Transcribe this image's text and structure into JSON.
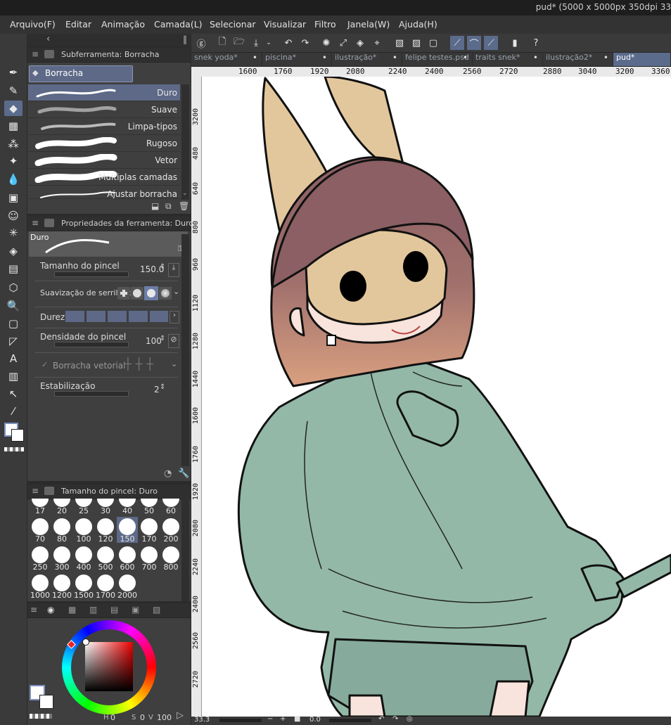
{
  "window": {
    "title": "pud* (5000 x 5000px 350dpi 33"
  },
  "menu": [
    "Arquivo(F)",
    "Editar",
    "Animação",
    "Camada(L)",
    "Selecionar",
    "Visualizar",
    "Filtro",
    "Janela(W)",
    "Ajuda(H)"
  ],
  "subtool_panel": {
    "title": "Subferramenta: Borracha",
    "group_tab": "Borracha",
    "items": [
      "Duro",
      "Suave",
      "Limpa-tipos",
      "Rugoso",
      "Vetor",
      "Múltiplas camadas",
      "Ajustar borracha"
    ],
    "selected": "Duro"
  },
  "tool_property": {
    "title": "Propriedades da ferramenta: Duro",
    "preview_label": "Duro",
    "brush_size_label": "Tamanho do pincel",
    "brush_size_value": "150.0",
    "antialias_label": "Suavização de serrilhado",
    "hardness_label": "Dureza",
    "density_label": "Densidade do pincel",
    "density_value": "100",
    "vector_eraser_label": "Borracha vetorial",
    "stabilization_label": "Estabilização",
    "stabilization_value": "2"
  },
  "brush_size_panel": {
    "title": "Tamanho do pincel: Duro",
    "sizes": [
      "17",
      "20",
      "25",
      "30",
      "40",
      "50",
      "60",
      "70",
      "80",
      "100",
      "120",
      "150",
      "170",
      "200",
      "250",
      "300",
      "400",
      "500",
      "600",
      "700",
      "800",
      "1000",
      "1200",
      "1500",
      "1700",
      "2000"
    ],
    "selected": "150"
  },
  "color_panel": {
    "bottom_values": [
      "0",
      "0",
      "100"
    ],
    "bottom_labels": [
      "H",
      "S",
      "V"
    ]
  },
  "canvas_tabs": [
    "snek yoda*",
    "piscina*",
    "ilustração*",
    "felipe testes.psd",
    "traits snek*",
    "ilustração2*",
    "pud*"
  ],
  "active_tab": "pud*",
  "ruler_top": [
    "1600",
    "1760",
    "1920",
    "2080",
    "2240",
    "2400",
    "2560",
    "2720",
    "2880",
    "3040",
    "3200",
    "3360"
  ],
  "ruler_left": [
    "3200",
    "480",
    "640",
    "800",
    "960",
    "1120",
    "1280",
    "1440",
    "1600",
    "1760",
    "1920",
    "2080",
    "2240",
    "2400",
    "2560",
    "2720"
  ],
  "status": {
    "zoom": "33.3",
    "angle": "0.0"
  },
  "colors": {
    "accent": "#5d6987",
    "hair_top": "#8b5f63",
    "hair_bottom": "#d9a080",
    "hoodie": "#93b8a8",
    "ears": "#e3c79c",
    "skin": "#f8e4dc"
  }
}
